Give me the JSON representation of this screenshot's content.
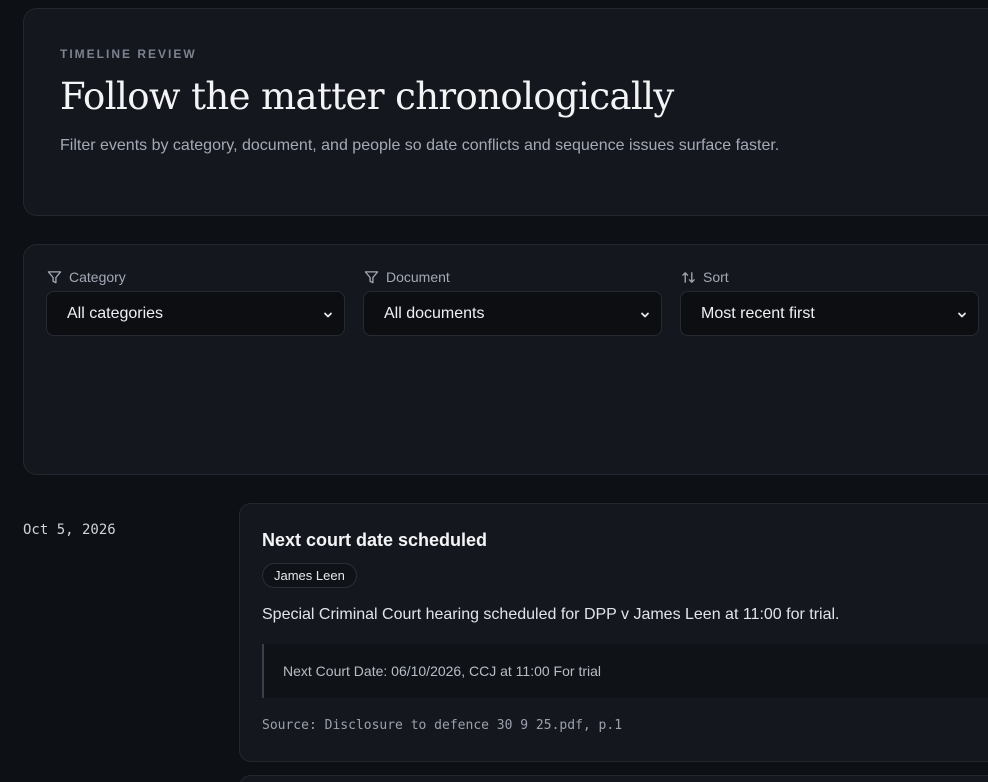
{
  "hero": {
    "eyebrow": "TIMELINE REVIEW",
    "title": "Follow the matter chronologically",
    "description": "Filter events by category, document, and people so date conflicts and sequence issues surface faster."
  },
  "filters": {
    "category": {
      "label": "Category",
      "value": "All categories",
      "icon": "filter-icon"
    },
    "document": {
      "label": "Document",
      "value": "All documents",
      "icon": "filter-icon"
    },
    "sort": {
      "label": "Sort",
      "value": "Most recent first",
      "icon": "sort-arrows-icon"
    }
  },
  "events": [
    {
      "date": "Oct 5, 2026",
      "title": "Next court date scheduled",
      "tags": [
        "James Leen"
      ],
      "description": "Special Criminal Court hearing scheduled for DPP v James Leen at 11:00 for trial.",
      "quote": "Next Court Date: 06/10/2026, CCJ at 11:00 For trial",
      "source": "Source: Disclosure to defence 30 9 25.pdf, p.1"
    }
  ]
}
